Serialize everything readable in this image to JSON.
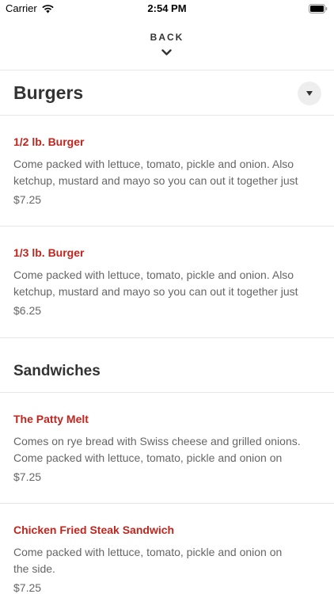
{
  "status_bar": {
    "carrier": "Carrier",
    "time": "2:54 PM"
  },
  "header": {
    "back_label": "BACK"
  },
  "colors": {
    "accent": "#c0251e",
    "text": "#333333",
    "muted": "#666666",
    "divider": "#e6e6e6"
  },
  "sections": [
    {
      "title": "Burgers",
      "items": [
        {
          "name": "1/2 lb. Burger",
          "description": "Come packed with lettuce, tomato, pickle and onion. Also\nketchup, mustard and mayo so you can out it together just",
          "price": "$7.25"
        },
        {
          "name": "1/3 lb. Burger",
          "description": "Come packed with lettuce, tomato, pickle and onion. Also\nketchup, mustard and mayo so you can out it together just",
          "price": "$6.25"
        }
      ]
    },
    {
      "title": "Sandwiches",
      "items": [
        {
          "name": "The Patty Melt",
          "description": "Comes on rye bread with Swiss cheese and grilled onions.\nCome packed with lettuce, tomato, pickle and onion on",
          "price": "$7.25"
        },
        {
          "name": "Chicken Fried Steak Sandwich",
          "description": "Come packed with lettuce, tomato, pickle and onion on\nthe side.",
          "price": "$7.25"
        }
      ]
    }
  ]
}
